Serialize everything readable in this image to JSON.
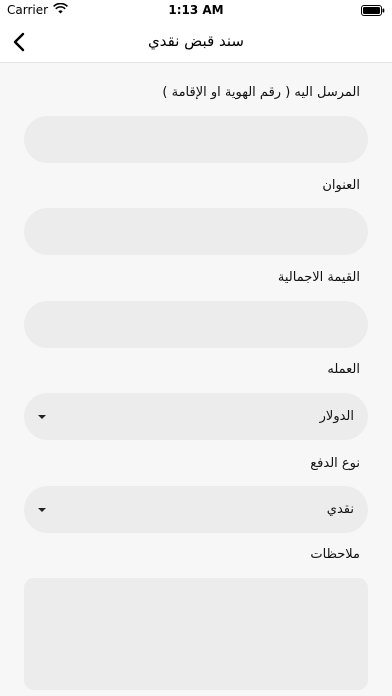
{
  "status_bar": {
    "carrier": "Carrier",
    "time": "1:13 AM",
    "icons": [
      "wifi-icon",
      "battery-icon"
    ]
  },
  "nav": {
    "title": "سند قبض نقدي",
    "back_icon": "chevron-left-icon"
  },
  "form": {
    "recipient_label": "المرسل اليه ( رقم الهوية او الإقامة )",
    "recipient_value": "",
    "address_label": "العنوان",
    "address_value": "",
    "total_label": "القيمة الاجمالية",
    "total_value": "",
    "currency_label": "العمله",
    "currency_value": "الدولار",
    "payment_type_label": "نوع الدفع",
    "payment_type_value": "نقدي",
    "notes_label": "ملاحظات",
    "notes_value": ""
  },
  "colors": {
    "field_bg": "#ececec",
    "page_bg": "#f7f7f7"
  }
}
